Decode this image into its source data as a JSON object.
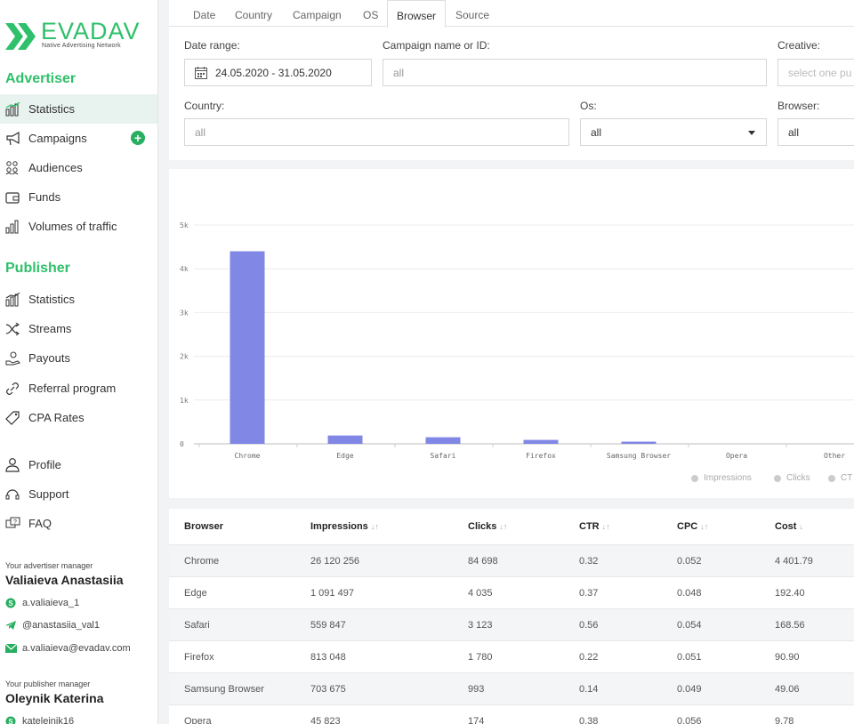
{
  "logo": {
    "brand": "EVADAV",
    "tagline": "Native Advertising Network"
  },
  "advertiser": {
    "title": "Advertiser",
    "items": [
      {
        "label": "Statistics",
        "icon": "bar-chart-icon",
        "active": true
      },
      {
        "label": "Campaigns",
        "icon": "megaphone-icon"
      },
      {
        "label": "Audiences",
        "icon": "audience-icon"
      },
      {
        "label": "Funds",
        "icon": "wallet-icon"
      },
      {
        "label": "Volumes of traffic",
        "icon": "volume-bars-icon"
      }
    ],
    "add_label": "+"
  },
  "publisher": {
    "title": "Publisher",
    "items": [
      {
        "label": "Statistics",
        "icon": "bar-chart-icon"
      },
      {
        "label": "Streams",
        "icon": "shuffle-icon"
      },
      {
        "label": "Payouts",
        "icon": "payout-icon"
      },
      {
        "label": "Referral program",
        "icon": "link-icon"
      },
      {
        "label": "CPA Rates",
        "icon": "tag-icon"
      }
    ]
  },
  "account": {
    "items": [
      {
        "label": "Profile",
        "icon": "user-icon"
      },
      {
        "label": "Support",
        "icon": "headset-icon"
      },
      {
        "label": "FAQ",
        "icon": "faq-icon"
      }
    ]
  },
  "advertiser_manager": {
    "caption": "Your advertiser manager",
    "name": "Valiaieva Anastasiia",
    "skype": "a.valiaieva_1",
    "telegram": "@anastasiia_val1",
    "email": "a.valiaieva@evadav.com"
  },
  "publisher_manager": {
    "caption": "Your publisher manager",
    "name": "Oleynik Katerina",
    "skype": "kateleinik16"
  },
  "tabs": [
    "Date",
    "Country",
    "Campaign",
    "OS",
    "Browser",
    "Source"
  ],
  "active_tab": "Browser",
  "filters": {
    "date_range_label": "Date range:",
    "date_range_value": "24.05.2020 - 31.05.2020",
    "campaign_label": "Campaign name or ID:",
    "campaign_placeholder": "all",
    "creative_label": "Creative:",
    "creative_placeholder": "select one pu",
    "country_label": "Country:",
    "country_placeholder": "all",
    "os_label": "Os:",
    "os_value": "all",
    "browser_label": "Browser:",
    "browser_value": "all"
  },
  "chart_data": {
    "type": "bar",
    "categories": [
      "Chrome",
      "Edge",
      "Safari",
      "Firefox",
      "Samsung Browser",
      "Opera",
      "Other"
    ],
    "series": [
      {
        "name": "Impressions",
        "values": [
          4400,
          190,
          150,
          90,
          50,
          0,
          0
        ]
      }
    ],
    "ylim": [
      0,
      5000
    ],
    "yticks": [
      "0",
      "1k",
      "2k",
      "3k",
      "4k",
      "5k"
    ],
    "ytick_values": [
      0,
      1000,
      2000,
      3000,
      4000,
      5000
    ],
    "bar_color": "#8087e4",
    "grid": true
  },
  "legend": [
    {
      "label": "Impressions"
    },
    {
      "label": "Clicks"
    },
    {
      "label": "CT"
    }
  ],
  "table": {
    "columns": [
      "Browser",
      "Impressions",
      "Clicks",
      "CTR",
      "CPC",
      "Cost"
    ],
    "sort_marks": [
      "",
      "↓↑",
      "↓↑",
      "↓↑",
      "↓↑",
      "↓"
    ],
    "rows": [
      [
        "Chrome",
        "26 120 256",
        "84 698",
        "0.32",
        "0.052",
        "4 401.79"
      ],
      [
        "Edge",
        "1 091 497",
        "4 035",
        "0.37",
        "0.048",
        "192.40"
      ],
      [
        "Safari",
        "559 847",
        "3 123",
        "0.56",
        "0.054",
        "168.56"
      ],
      [
        "Firefox",
        "813 048",
        "1 780",
        "0.22",
        "0.051",
        "90.90"
      ],
      [
        "Samsung Browser",
        "703 675",
        "993",
        "0.14",
        "0.049",
        "49.06"
      ],
      [
        "Opera",
        "45 823",
        "174",
        "0.38",
        "0.056",
        "9.78"
      ]
    ]
  }
}
